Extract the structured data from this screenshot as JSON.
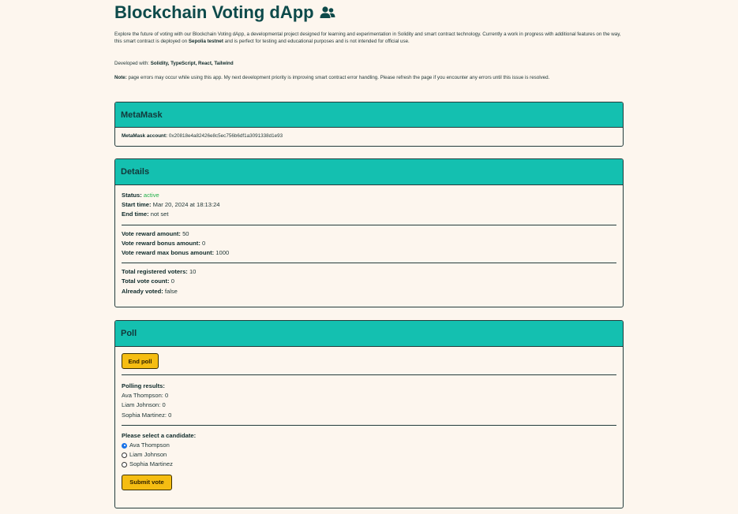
{
  "header": {
    "title": "Blockchain Voting dApp",
    "icon": "users-icon"
  },
  "intro": {
    "p1_a": "Explore the future of voting with our Blockchain Voting dApp, a developmental project designed for learning and experimentation in Solidity and smart contract technology. Currently a work in progress with additional features on the way, this smart contract is deployed on ",
    "p1_network": "Sepolia testnet",
    "p1_b": " and is perfect for testing and educational purposes and is not intended for official use.",
    "p2_label": "Developed with: ",
    "p2_tech": "Solidity, TypeScript, React, Tailwind",
    "p3_label": "Note:",
    "p3_text": " page errors may occur while using this app. My next development priority is improving smart contract error handling. Please refresh the page if you encounter any errors until this issue is resolved."
  },
  "metamask": {
    "title": "MetaMask",
    "account_label": "MetaMask account:",
    "account_value": " 0x20818e4a82426e8c5ec756b6df1a3091338d1e93"
  },
  "details": {
    "title": "Details",
    "status_label": "Status:",
    "status_value": "active",
    "start_label": "Start time:",
    "start_value": " Mar 20, 2024 at 18:13:24",
    "end_label": "End time:",
    "end_value": " not set",
    "reward_label": "Vote reward amount:",
    "reward_value": " 50",
    "bonus_label": "Vote reward bonus amount:",
    "bonus_value": " 0",
    "max_bonus_label": "Vote reward max bonus amount:",
    "max_bonus_value": " 1000",
    "voters_label": "Total registered voters:",
    "voters_value": " 10",
    "votes_label": "Total vote count:",
    "votes_value": " 0",
    "voted_label": "Already voted:",
    "voted_value": " false"
  },
  "poll": {
    "title": "Poll",
    "end_button": "End poll",
    "results_label": "Polling results:",
    "results": [
      "Ava Thompson: 0",
      "Liam Johnson: 0",
      "Sophia Martinez: 0"
    ],
    "select_label": "Please select a candidate:",
    "candidates": [
      "Ava Thompson",
      "Liam Johnson",
      "Sophia Martinez"
    ],
    "selected_candidate": "Ava Thompson",
    "submit_button": "Submit vote"
  },
  "colors": {
    "background": "#fdf6ee",
    "header_teal": "#14c0b0",
    "title": "#0d4a4a",
    "button_yellow": "#f5bd12",
    "status_green": "#22b04a"
  }
}
